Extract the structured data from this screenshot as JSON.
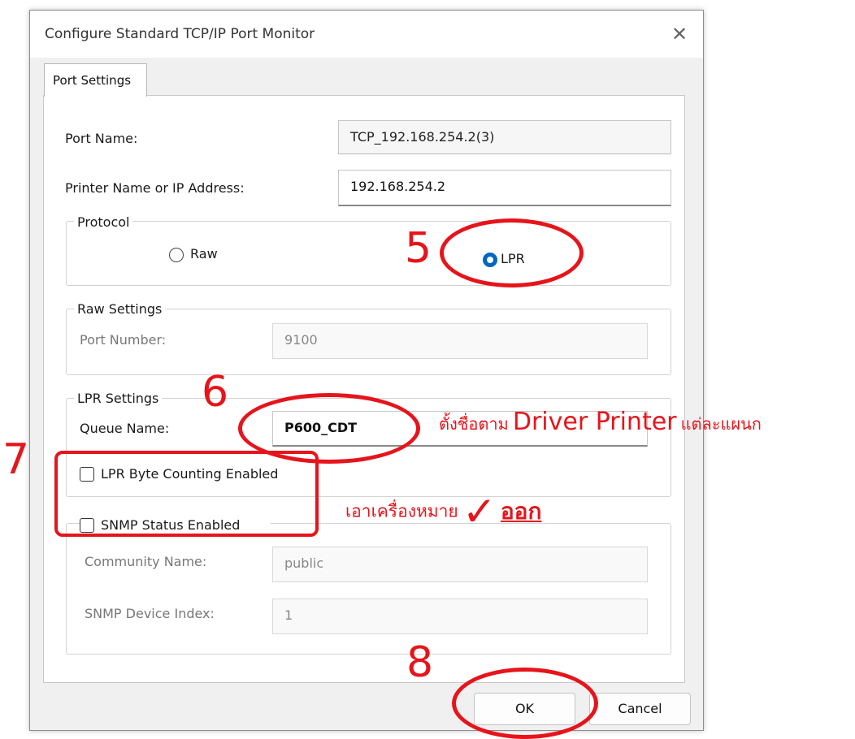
{
  "window": {
    "title": "Configure Standard TCP/IP Port Monitor",
    "close_glyph": "✕"
  },
  "tabs": [
    {
      "label": "Port Settings"
    }
  ],
  "port_name": {
    "label": "Port Name:",
    "value": "TCP_192.168.254.2(3)"
  },
  "printer_name": {
    "label": "Printer Name or IP Address:",
    "value": "192.168.254.2"
  },
  "protocol": {
    "title": "Protocol",
    "options": [
      {
        "label": "Raw",
        "selected": false
      },
      {
        "label": "LPR",
        "selected": true
      }
    ]
  },
  "raw_settings": {
    "title": "Raw Settings",
    "port_number_label": "Port Number:",
    "port_number_value": "9100"
  },
  "lpr_settings": {
    "title": "LPR Settings",
    "queue_name_label": "Queue Name:",
    "queue_name_value": "P600_CDT",
    "byte_counting_label": "LPR Byte Counting Enabled",
    "byte_counting_checked": false
  },
  "snmp": {
    "status_label": "SNMP Status Enabled",
    "status_checked": false,
    "community_label": "Community Name:",
    "community_value": "public",
    "device_index_label": "SNMP Device Index:",
    "device_index_value": "1"
  },
  "buttons": {
    "ok": "OK",
    "cancel": "Cancel"
  },
  "annotations": {
    "step5": "5",
    "step6": "6",
    "step7": "7",
    "step8": "8",
    "queue_note_prefix": "ตั้งชื่อตาม",
    "queue_note_driver": "Driver Printer",
    "queue_note_suffix": "แต่ละแผนก",
    "uncheck_note": "เอาเครื่องหมาย",
    "uncheck_mark": "✓",
    "uncheck_out": "ออก",
    "annotation_color": "#e6141b"
  },
  "colors": {
    "radio_selected": "#0067c0",
    "dialog_bg": "#f0f0f0"
  }
}
